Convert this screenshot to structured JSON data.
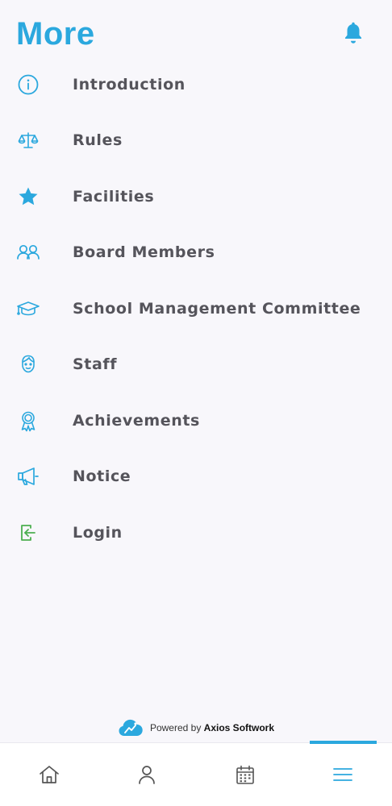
{
  "header": {
    "title": "More",
    "bell_icon": "bell-icon"
  },
  "colors": {
    "accent": "#2ba8de",
    "label": "#55545b",
    "login_icon": "#4caf50",
    "background": "#f8f7fb"
  },
  "menu": {
    "items": [
      {
        "label": "Introduction",
        "icon": "info-icon"
      },
      {
        "label": "Rules",
        "icon": "scales-icon"
      },
      {
        "label": "Facilities",
        "icon": "star-icon"
      },
      {
        "label": "Board Members",
        "icon": "people-icon"
      },
      {
        "label": "School Management Committee",
        "icon": "graduation-cap-icon"
      },
      {
        "label": "Staff",
        "icon": "face-icon"
      },
      {
        "label": "Achievements",
        "icon": "award-ribbon-icon"
      },
      {
        "label": "Notice",
        "icon": "megaphone-icon"
      },
      {
        "label": "Login",
        "icon": "login-icon"
      }
    ]
  },
  "footer": {
    "powered_by": "Powered by",
    "brand": "Axios Softwork"
  },
  "bottom_nav": {
    "items": [
      {
        "icon": "home-icon"
      },
      {
        "icon": "person-icon"
      },
      {
        "icon": "calendar-icon"
      },
      {
        "icon": "menu-icon",
        "active": true
      }
    ]
  }
}
